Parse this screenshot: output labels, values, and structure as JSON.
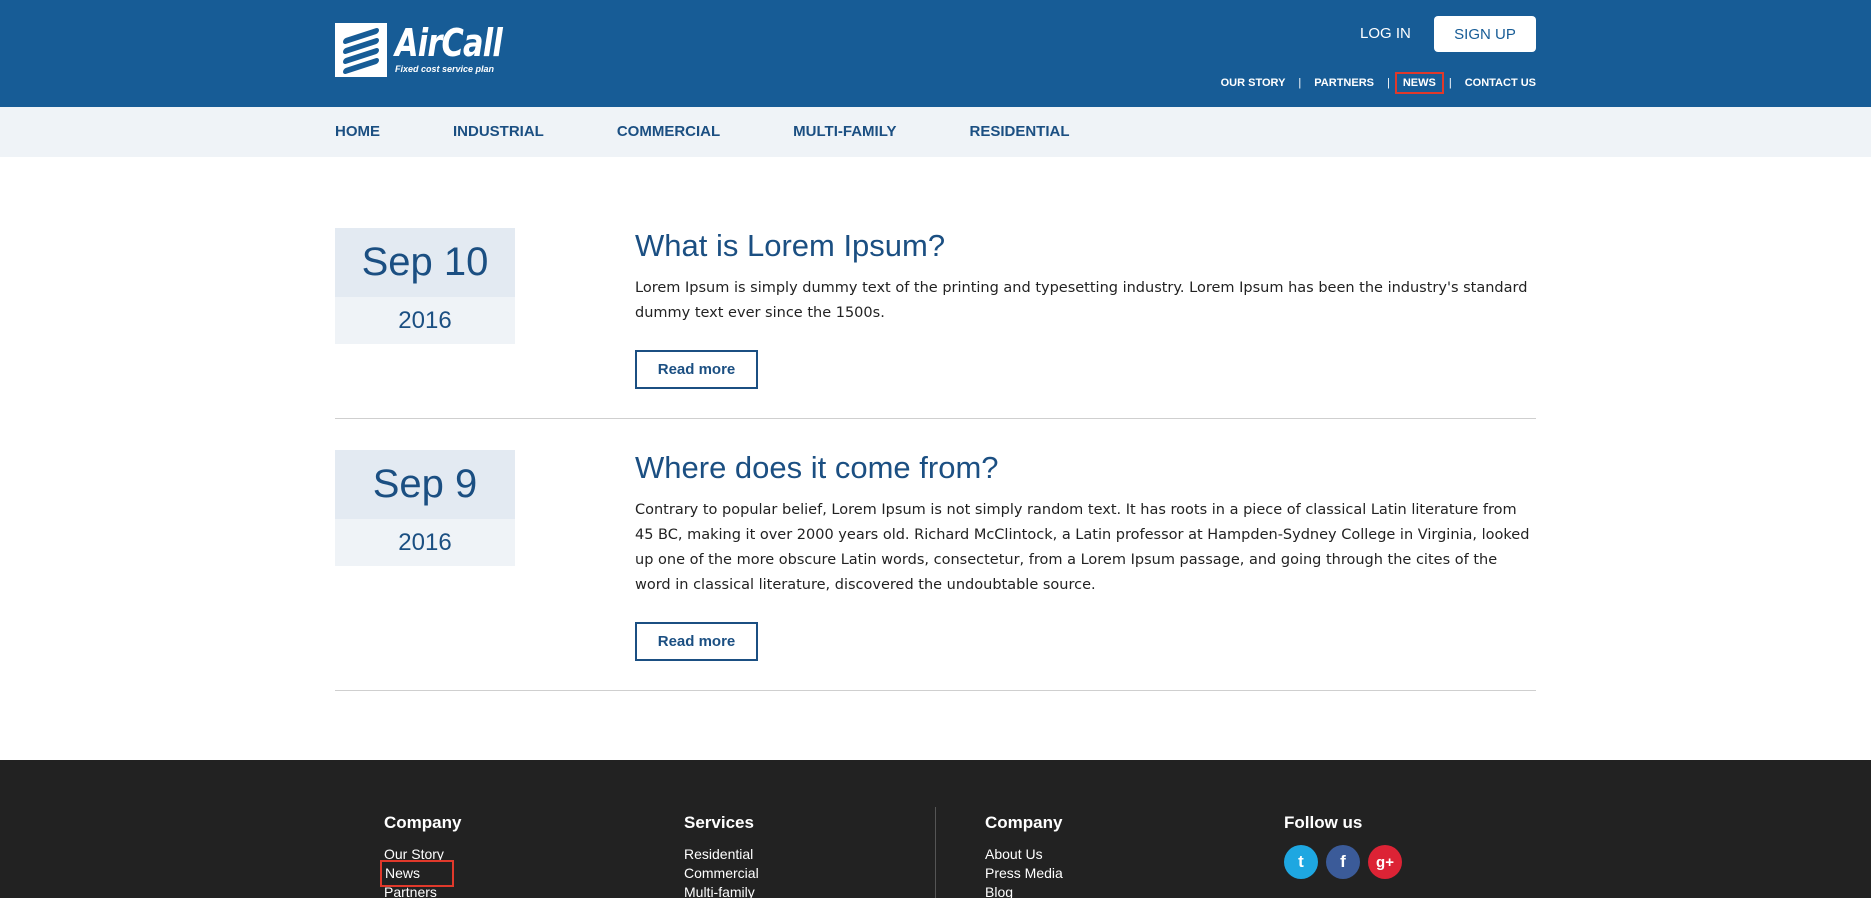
{
  "header": {
    "logo_name": "AirCall",
    "logo_tagline": "Fixed cost service plan",
    "login_label": "LOG IN",
    "signup_label": "SIGN UP",
    "util_nav": [
      {
        "label": "OUR STORY"
      },
      {
        "label": "PARTNERS"
      },
      {
        "label": "NEWS"
      },
      {
        "label": "CONTACT US"
      }
    ],
    "separator": "|"
  },
  "main_nav": [
    "HOME",
    "INDUSTRIAL",
    "COMMERCIAL",
    "MULTI-FAMILY",
    "RESIDENTIAL"
  ],
  "articles": [
    {
      "day": "Sep 10",
      "year": "2016",
      "title": "What is Lorem Ipsum?",
      "body": "Lorem Ipsum is simply dummy text of the printing and typesetting industry. Lorem Ipsum has been the industry's standard dummy text ever since the 1500s.",
      "read_more": "Read more"
    },
    {
      "day": "Sep 9",
      "year": "2016",
      "title": "Where does it come from?",
      "body": "Contrary to popular belief, Lorem Ipsum is not simply random text. It has roots in a piece of classical Latin literature from 45 BC, making it over 2000 years old. Richard McClintock, a Latin professor at Hampden-Sydney College in Virginia, looked up one of the more obscure Latin words, consectetur, from a Lorem Ipsum passage, and going through the cites of the word in classical literature, discovered the undoubtable source.",
      "read_more": "Read more"
    }
  ],
  "footer": {
    "col1": {
      "title": "Company",
      "links": [
        "Our Story",
        "News",
        "Partners"
      ]
    },
    "col2": {
      "title": "Services",
      "links": [
        "Residential",
        "Commercial",
        "Multi-family"
      ]
    },
    "col3": {
      "title": "Company",
      "links": [
        "About Us",
        "Press Media",
        "Blog"
      ]
    },
    "col4": {
      "title": "Follow us",
      "social": [
        "twitter-icon",
        "facebook-icon",
        "google-plus-icon"
      ],
      "social_glyphs": [
        "t",
        "f",
        "g+"
      ]
    }
  },
  "colors": {
    "brand_blue": "#175c96",
    "nav_bg": "#eff3f7",
    "footer_bg": "#222222",
    "highlight": "#e0392b"
  }
}
